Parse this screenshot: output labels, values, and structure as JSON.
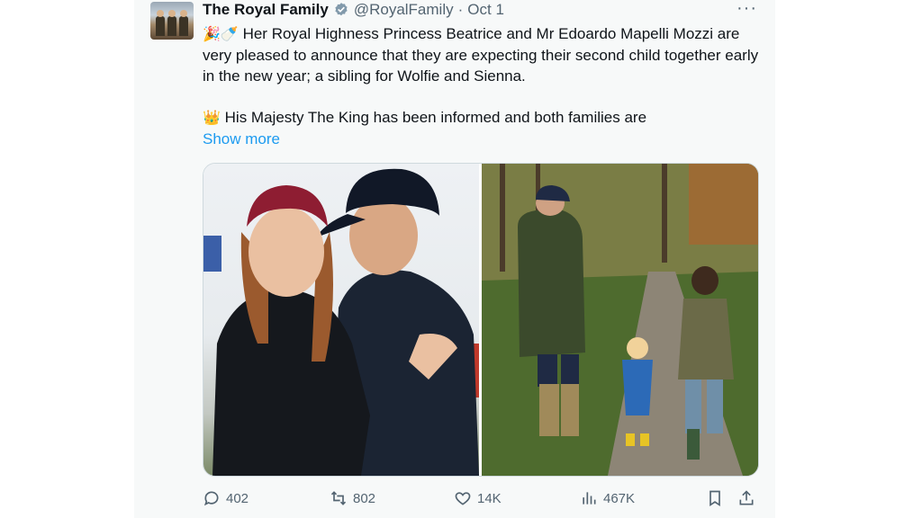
{
  "tweet": {
    "author_name": "The Royal Family",
    "handle": "@RoyalFamily",
    "separator": "·",
    "date": "Oct 1",
    "more_menu": "···",
    "emoji_line1": "🎉🍼",
    "paragraph1": "Her Royal Highness Princess Beatrice and Mr Edoardo Mapelli Mozzi are very pleased to announce that they are expecting their second child together early in the new year; a sibling for Wolfie and Sienna.",
    "emoji_line2": "👑",
    "paragraph2": "His Majesty The King has been informed and both families are",
    "show_more": "Show more"
  },
  "actions": {
    "replies": "402",
    "reposts": "802",
    "likes": "14K",
    "views": "467K"
  },
  "colors": {
    "link": "#1d9bf0",
    "verified": "#829aab",
    "muted": "#536471"
  }
}
